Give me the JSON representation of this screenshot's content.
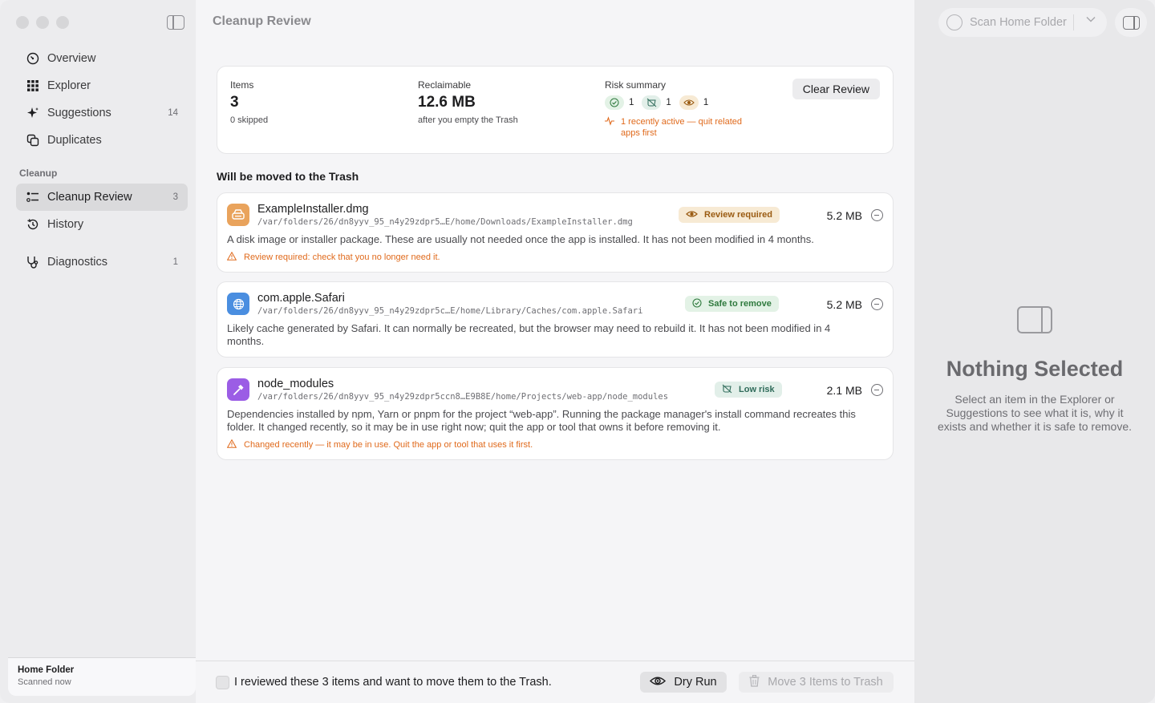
{
  "sidebar": {
    "items": [
      {
        "label": "Overview",
        "icon": "gauge-icon"
      },
      {
        "label": "Explorer",
        "icon": "grid-icon"
      },
      {
        "label": "Suggestions",
        "icon": "sparkle-icon",
        "count": "14"
      },
      {
        "label": "Duplicates",
        "icon": "duplicate-icon"
      }
    ],
    "section_label": "Cleanup",
    "cleanup_items": [
      {
        "label": "Cleanup Review",
        "icon": "checklist-icon",
        "count": "3",
        "active": true
      },
      {
        "label": "History",
        "icon": "history-icon"
      }
    ],
    "diagnostics": {
      "label": "Diagnostics",
      "icon": "stethoscope-icon",
      "count": "1"
    },
    "footer": {
      "title": "Home Folder",
      "subtitle": "Scanned now"
    }
  },
  "main": {
    "title": "Cleanup Review",
    "summary": {
      "items_label": "Items",
      "items_value": "3",
      "items_sub": "0 skipped",
      "reclaim_label": "Reclaimable",
      "reclaim_value": "12.6 MB",
      "reclaim_sub": "after you empty the Trash",
      "risk_label": "Risk summary",
      "risk_counts": {
        "safe": "1",
        "low": "1",
        "review": "1"
      },
      "risk_warning": "1 recently active — quit related apps first",
      "clear_button": "Clear Review"
    },
    "section_title": "Will be moved to the Trash",
    "items": [
      {
        "name": "ExampleInstaller.dmg",
        "path": "/var/folders/26/dn8yyv_95_n4y29zdpr5…E/home/Downloads/ExampleInstaller.dmg",
        "badge": "Review required",
        "badge_color": "#9a5b12",
        "badge_bg": "#f7ead4",
        "size": "5.2 MB",
        "description": "A disk image or installer package. These are usually not needed once the app is installed. It has not been modified in 4 months.",
        "warning": "Review required: check that you no longer need it.",
        "icon_bg": "#e9a35c"
      },
      {
        "name": "com.apple.Safari",
        "path": "/var/folders/26/dn8yyv_95_n4y29zdpr5c…E/home/Library/Caches/com.apple.Safari",
        "badge": "Safe to remove",
        "badge_color": "#2f7a3e",
        "badge_bg": "#e3f2e6",
        "size": "5.2 MB",
        "description": "Likely cache generated by Safari. It can normally be recreated, but the browser may need to rebuild it. It has not been modified in 4 months.",
        "warning": "",
        "icon_bg": "#4a8ee0"
      },
      {
        "name": "node_modules",
        "path": "/var/folders/26/dn8yyv_95_n4y29zdpr5ccn8…E9B8E/home/Projects/web-app/node_modules",
        "badge": "Low risk",
        "badge_color": "#2f6b5a",
        "badge_bg": "#e2efe9",
        "size": "2.1 MB",
        "description": "Dependencies installed by npm, Yarn or pnpm for the project “web-app”. Running the package manager's install command recreates this folder. It changed recently, so it may be in use right now; quit the app or tool that owns it before removing it.",
        "warning": "Changed recently — it may be in use. Quit the app or tool that uses it first.",
        "icon_bg": "#9b5de5"
      }
    ],
    "bottom": {
      "confirm_label": "I reviewed these 3 items and want to move them to the Trash.",
      "dry_run": "Dry Run",
      "move_button": "Move 3 Items to Trash"
    }
  },
  "inspector": {
    "scan_button": "Scan Home Folder",
    "empty_title": "Nothing Selected",
    "empty_sub": "Select an item in the Explorer or Suggestions to see what it is, why it exists and whether it is safe to remove."
  }
}
